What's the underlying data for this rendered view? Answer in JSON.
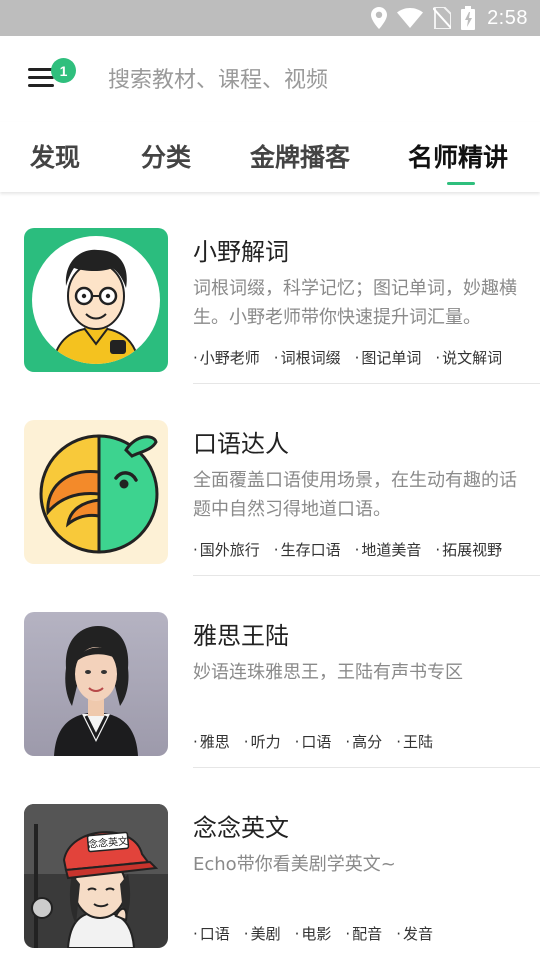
{
  "status_bar": {
    "time": "2:58",
    "icons": [
      "location-icon",
      "wifi-icon",
      "no-sim-icon",
      "battery-icon"
    ],
    "background": "#bdbdbd"
  },
  "header": {
    "menu_icon": "hamburger-menu-icon",
    "badge_count": "1",
    "badge_color": "#2fbf7d",
    "search_placeholder": "搜索教材、课程、视频"
  },
  "tabs": [
    {
      "label": "发现",
      "active": false
    },
    {
      "label": "分类",
      "active": false
    },
    {
      "label": "金牌播客",
      "active": false
    },
    {
      "label": "名师精讲",
      "active": true
    }
  ],
  "accent_color": "#2fbf7d",
  "items": [
    {
      "title": "小野解词",
      "description": "词根词缀，科学记忆；图记单词，妙趣横生。小野老师带你快速提升词汇量。",
      "tags": [
        "小野老师",
        "词根词缀",
        "图记单词",
        "说文解词"
      ],
      "thumbnail": "cartoon-teacher-avatar"
    },
    {
      "title": "口语达人",
      "description": "全面覆盖口语使用场景，在生动有趣的话题中自然习得地道口语。",
      "tags": [
        "国外旅行",
        "生存口语",
        "地道美音",
        "拓展视野"
      ],
      "thumbnail": "parrot-logo"
    },
    {
      "title": "雅思王陆",
      "description": "妙语连珠雅思王，王陆有声书专区",
      "tags": [
        "雅思",
        "听力",
        "口语",
        "高分",
        "王陆"
      ],
      "thumbnail": "teacher-photo"
    },
    {
      "title": "念念英文",
      "description": "Echo带你看美剧学英文~",
      "tags": [
        "口语",
        "美剧",
        "电影",
        "配音",
        "发音"
      ],
      "thumbnail": "cartoon-girl-with-cap",
      "thumbnail_cap_text": "念念英文"
    }
  ]
}
